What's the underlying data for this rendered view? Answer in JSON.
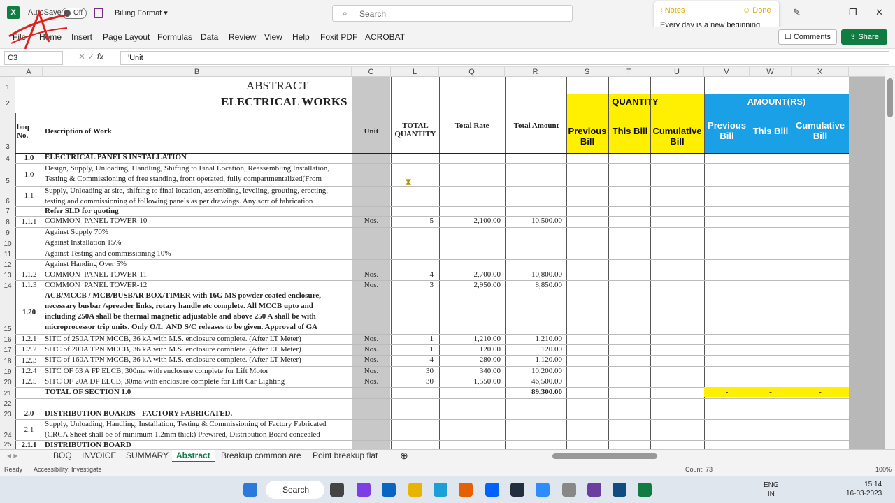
{
  "titlebar": {
    "autosave": "AutoSave",
    "toggle": "Off",
    "doc_title": "Billing Format",
    "search_placeholder": "Search"
  },
  "notes": {
    "back": "Notes",
    "done": "Done",
    "text": "Every day is a new beginning"
  },
  "menu": [
    "File",
    "Home",
    "Insert",
    "Page Layout",
    "Formulas",
    "Data",
    "Review",
    "View",
    "Help",
    "Foxit PDF",
    "ACROBAT"
  ],
  "comments": "Comments",
  "share": "Share",
  "formula": {
    "cell": "C3",
    "content": "'Unit"
  },
  "columns": [
    "A",
    "B",
    "C",
    "L",
    "Q",
    "R",
    "S",
    "T",
    "U",
    "V",
    "W",
    "X"
  ],
  "sheet_title": "ABSTRACT",
  "sheet_subtitle": "ELECTRICAL WORKS",
  "headers": {
    "boq": "boq No.",
    "desc": "Description of Work",
    "unit": "Unit",
    "tq": "TOTAL QUANTITY",
    "rate": "Total Rate",
    "amount": "Total Amount",
    "quantity": "QUANTITY",
    "amount_rs": "AMOUNT(RS)",
    "prev": "Previous Bill",
    "this": "This Bill",
    "cum": "Cumulative Bill"
  },
  "rows": [
    {
      "n": "4",
      "boq": "1.0",
      "desc": "ELECTRICAL PANELS INSTALLATION",
      "bold": true,
      "unit": "",
      "qty": "",
      "rate": "",
      "amt": ""
    },
    {
      "n": "5",
      "boq": "1.0",
      "desc": "Design, Supply, Unloading, Handling, Shifting to Final Location, Reassembling,Installation,",
      "desc2": "Testing & Commissioning of free standing, front operated, fully compartmentalized(From",
      "unit": "",
      "qty": "",
      "rate": "",
      "amt": ""
    },
    {
      "n": "6",
      "boq": "1.1",
      "desc": "Supply, Unloading at site, shifting to final location, assembling, leveling, grouting, erecting,",
      "desc2": "testing and commissioning of following panels as per drawings. Any sort of fabrication",
      "unit": "",
      "qty": "",
      "rate": "",
      "amt": ""
    },
    {
      "n": "7",
      "boq": "",
      "desc": "Refer SLD for quoting",
      "bold": true,
      "unit": "",
      "qty": "",
      "rate": "",
      "amt": ""
    },
    {
      "n": "8",
      "boq": "1.1.1",
      "desc": "COMMON  PANEL TOWER-10",
      "unit": "Nos.",
      "qty": "5",
      "rate": "2,100.00",
      "amt": "10,500.00"
    },
    {
      "n": "9",
      "boq": "",
      "desc": "Against Supply 70%",
      "unit": "",
      "qty": "",
      "rate": "",
      "amt": ""
    },
    {
      "n": "10",
      "boq": "",
      "desc": "Against Installation 15%",
      "unit": "",
      "qty": "",
      "rate": "",
      "amt": ""
    },
    {
      "n": "11",
      "boq": "",
      "desc": "Against Testing and commissioning 10%",
      "unit": "",
      "qty": "",
      "rate": "",
      "amt": ""
    },
    {
      "n": "12",
      "boq": "",
      "desc": "Against Handing Over 5%",
      "unit": "",
      "qty": "",
      "rate": "",
      "amt": ""
    },
    {
      "n": "13",
      "boq": "1.1.2",
      "desc": "COMMON  PANEL TOWER-11",
      "unit": "Nos.",
      "qty": "4",
      "rate": "2,700.00",
      "amt": "10,800.00"
    },
    {
      "n": "14",
      "boq": "1.1.3",
      "desc": "COMMON  PANEL TOWER-12",
      "unit": "Nos.",
      "qty": "3",
      "rate": "2,950.00",
      "amt": "8,850.00"
    },
    {
      "n": "15",
      "boq": "1.20",
      "desc": "ACB/MCCB / MCB/BUSBAR BOX/TIMER with 16G MS powder coated enclosure,",
      "desc2": "necessary busbar /spreader links, rotary handle etc complete. All MCCB upto and",
      "desc3": "including 250A shall be thermal magnetic adjustable and above 250 A shall be with",
      "desc4": "microprocessor trip units. Only O/L  AND S/C releases to be given. Approval of GA",
      "bold": true,
      "unit": "",
      "qty": "",
      "rate": "",
      "amt": ""
    },
    {
      "n": "16",
      "boq": "1.2.1",
      "desc": "SITC of 250A TPN MCCB, 36 kA with M.S. enclosure complete. (After LT Meter)",
      "unit": "Nos.",
      "qty": "1",
      "rate": "1,210.00",
      "amt": "1,210.00"
    },
    {
      "n": "17",
      "boq": "1.2.2",
      "desc": "SITC of 200A TPN MCCB, 36 kA with M.S. enclosure complete. (After LT Meter)",
      "unit": "Nos.",
      "qty": "1",
      "rate": "120.00",
      "amt": "120.00"
    },
    {
      "n": "18",
      "boq": "1.2.3",
      "desc": "SITC of 160A TPN MCCB, 36 kA with M.S. enclosure complete. (After LT Meter)",
      "unit": "Nos.",
      "qty": "4",
      "rate": "280.00",
      "amt": "1,120.00"
    },
    {
      "n": "19",
      "boq": "1.2.4",
      "desc": "SITC OF 63 A FP ELCB, 300ma with enclosure complete for Lift Motor",
      "unit": "Nos.",
      "qty": "30",
      "rate": "340.00",
      "amt": "10,200.00"
    },
    {
      "n": "20",
      "boq": "1.2.5",
      "desc": "SITC OF 20A DP ELCB, 30ma with enclosure complete for Lift Car Lighting",
      "unit": "Nos.",
      "qty": "30",
      "rate": "1,550.00",
      "amt": "46,500.00"
    },
    {
      "n": "21",
      "boq": "",
      "desc": "TOTAL OF SECTION 1.0",
      "bold": true,
      "unit": "",
      "qty": "",
      "rate": "",
      "amt": "89,300.00",
      "dash": "-"
    },
    {
      "n": "22",
      "boq": "",
      "desc": "",
      "unit": "",
      "qty": "",
      "rate": "",
      "amt": ""
    },
    {
      "n": "23",
      "boq": "2.0",
      "desc": "DISTRIBUTION BOARDS - FACTORY FABRICATED.",
      "bold": true,
      "unit": "",
      "qty": "",
      "rate": "",
      "amt": ""
    },
    {
      "n": "24",
      "boq": "2.1",
      "desc": "Supply, Unloading, Handling, Installation, Testing & Commissioning of Factory Fabricated",
      "desc2": "(CRCA Sheet shall be of minimum 1.2mm thick) Prewired, Distribution Board concealed",
      "unit": "",
      "qty": "",
      "rate": "",
      "amt": ""
    },
    {
      "n": "25",
      "boq": "2.1.1",
      "desc": "DISTRIBUTION BOARD",
      "bold": true,
      "unit": "",
      "qty": "",
      "rate": "",
      "amt": ""
    }
  ],
  "sheet_tabs": [
    "BOQ",
    "INVOICE",
    "SUMMARY",
    "Abstract",
    "Breakup common are",
    "Point breakup flat"
  ],
  "status": {
    "ready": "Ready",
    "access": "Accessibility: Investigate",
    "count": "Count: 73",
    "zoom": "100%"
  },
  "taskbar": {
    "search": "Search",
    "lang1": "ENG",
    "lang2": "IN",
    "time": "15:14",
    "date": "16-03-2023"
  }
}
